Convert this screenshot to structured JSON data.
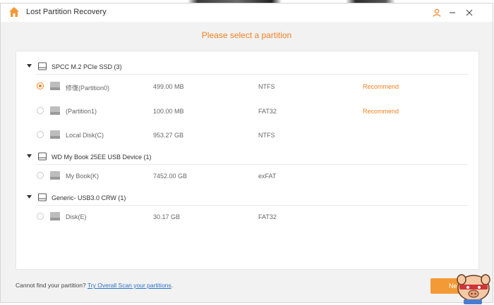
{
  "window": {
    "title": "Lost Partition Recovery",
    "subtitle": "Please select a partition",
    "accent_color": "#f08224",
    "icons": [
      "home-icon",
      "user-icon",
      "minimize-icon",
      "close-icon"
    ]
  },
  "disks": [
    {
      "name": "SPCC M.2 PCIe SSD (3)",
      "partitions": [
        {
          "name": "修復(Partition0)",
          "size": "499.00 MB",
          "fs": "NTFS",
          "recommend": "Recommend",
          "selected": true
        },
        {
          "name": "(Partition1)",
          "size": "100.00 MB",
          "fs": "FAT32",
          "recommend": "Recommend",
          "selected": false
        },
        {
          "name": "Local Disk(C)",
          "size": "953.27 GB",
          "fs": "NTFS",
          "recommend": "",
          "selected": false
        }
      ]
    },
    {
      "name": "WD My Book 25EE USB Device (1)",
      "partitions": [
        {
          "name": "My Book(K)",
          "size": "7452.00 GB",
          "fs": "exFAT",
          "recommend": "",
          "selected": false
        }
      ]
    },
    {
      "name": "Generic- USB3.0 CRW (1)",
      "partitions": [
        {
          "name": "Disk(E)",
          "size": "30.17 GB",
          "fs": "FAT32",
          "recommend": "",
          "selected": false
        }
      ]
    }
  ],
  "footer": {
    "prompt": "Cannot find your partition?",
    "link": "Try Overall Scan your partitions",
    "period": "."
  },
  "next_button": {
    "label": "Ne"
  }
}
